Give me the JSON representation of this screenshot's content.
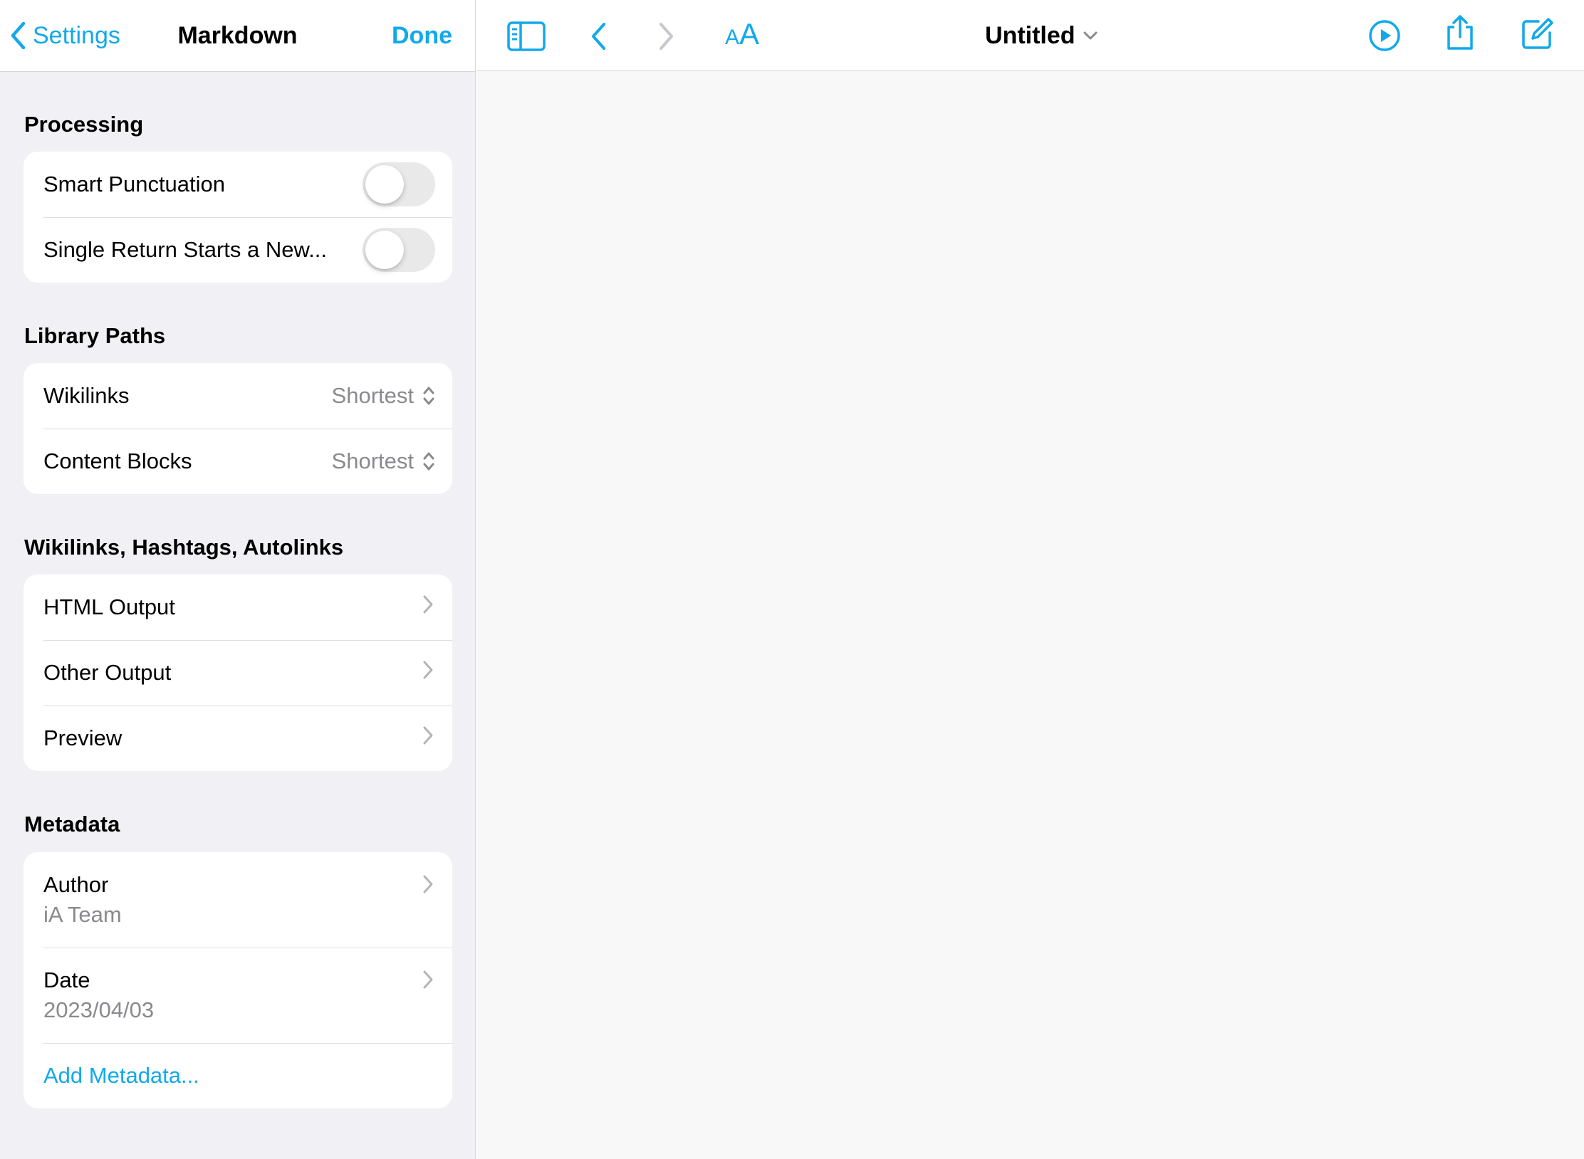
{
  "settings_panel": {
    "back_label": "Settings",
    "title": "Markdown",
    "done_label": "Done",
    "sections": {
      "processing": {
        "header": "Processing",
        "smart_punctuation": {
          "label": "Smart Punctuation",
          "on": false
        },
        "single_return": {
          "label": "Single Return Starts a New...",
          "on": false
        }
      },
      "library_paths": {
        "header": "Library Paths",
        "wikilinks": {
          "label": "Wikilinks",
          "value": "Shortest"
        },
        "content_blocks": {
          "label": "Content Blocks",
          "value": "Shortest"
        }
      },
      "links": {
        "header": "Wikilinks, Hashtags, Autolinks",
        "items": [
          "HTML Output",
          "Other Output",
          "Preview"
        ]
      },
      "metadata": {
        "header": "Metadata",
        "author": {
          "label": "Author",
          "value": "iA Team"
        },
        "date": {
          "label": "Date",
          "value": "2023/04/03"
        },
        "add_label": "Add Metadata..."
      }
    }
  },
  "toolbar": {
    "font_size_small": "A",
    "font_size_big": "A",
    "document_title": "Untitled",
    "icons": [
      "sidebar-icon",
      "back-arrow-icon",
      "forward-arrow-icon",
      "font-size-icon",
      "chevron-down-icon",
      "play-icon",
      "share-icon",
      "compose-icon"
    ]
  },
  "colors": {
    "accent": "#12a9ea",
    "panel_background": "#f1f0f5",
    "editor_background": "#f8f8f9",
    "secondary_text": "#8a8a8e",
    "toggle_off": "#e9e9ea"
  }
}
